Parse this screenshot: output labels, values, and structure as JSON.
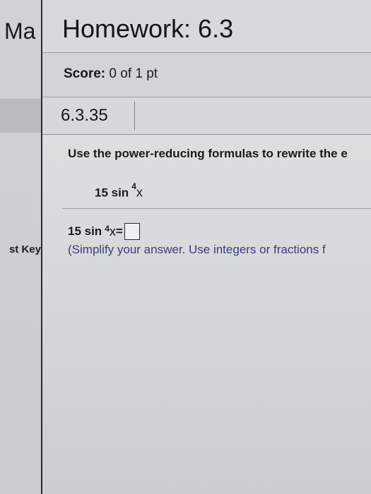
{
  "app": {
    "title": "Ma"
  },
  "sidebar": {
    "test_key_label": "st Key"
  },
  "homework": {
    "title": "Homework: 6.3"
  },
  "score": {
    "label": "Score:",
    "value": "0 of 1 pt"
  },
  "problem": {
    "id": "6.3.35",
    "instruction": "Use the power-reducing formulas to rewrite the e",
    "expression": {
      "coefficient_fn": "15 sin",
      "exponent": "4",
      "variable": "x"
    },
    "answer": {
      "coefficient_fn": "15 sin",
      "exponent": "4",
      "variable": "x",
      "equals": "=",
      "input_value": ""
    },
    "hint": "(Simplify your answer. Use integers or fractions f"
  }
}
